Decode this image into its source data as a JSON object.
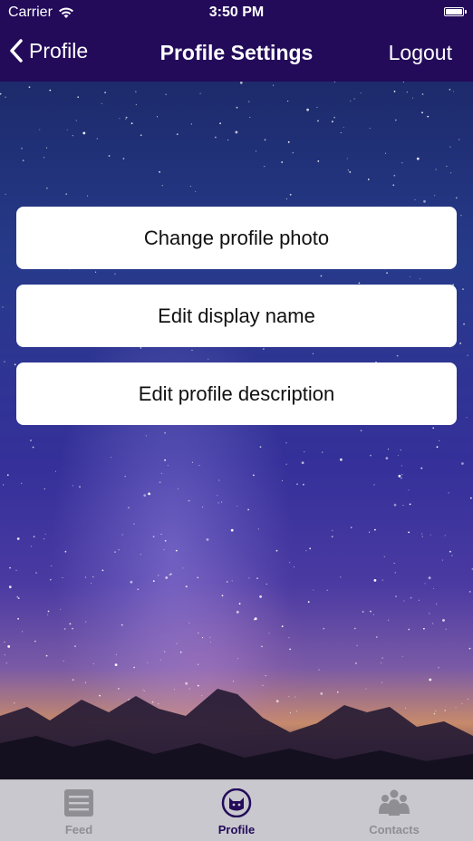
{
  "status_bar": {
    "carrier": "Carrier",
    "time": "3:50 PM"
  },
  "nav": {
    "back_label": "Profile",
    "title": "Profile Settings",
    "logout_label": "Logout"
  },
  "settings": [
    {
      "label": "Change profile photo"
    },
    {
      "label": "Edit display name"
    },
    {
      "label": "Edit profile description"
    }
  ],
  "tabs": [
    {
      "label": "Feed",
      "icon": "feed-icon",
      "active": false
    },
    {
      "label": "Profile",
      "icon": "cat-profile-icon",
      "active": true
    },
    {
      "label": "Contacts",
      "icon": "contacts-icon",
      "active": false
    }
  ],
  "colors": {
    "nav_background": "#230b5a",
    "tab_active": "#230b5a",
    "tab_inactive": "#8e8e93",
    "tab_bar_background": "#c9c8ce"
  }
}
